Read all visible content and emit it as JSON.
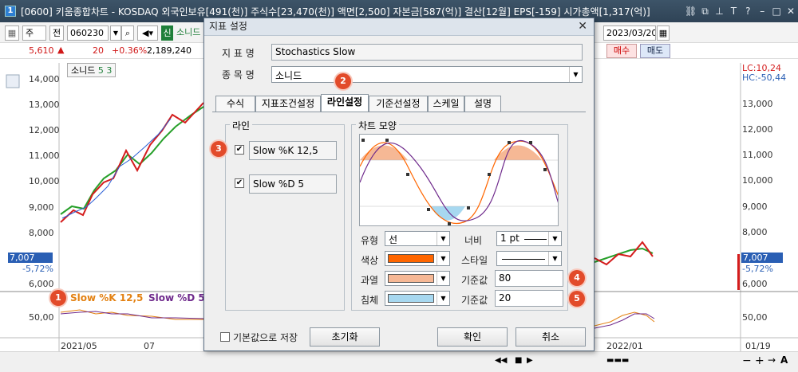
{
  "window": {
    "title": "[0600] 키움종합차트 - KOSDAQ 외국인보유[491(천)] 주식수[23,470(천)] 액면[2,500] 자본금[587(억)] 결산[12월] EPS[-159] 시가총액[1,317(억)]",
    "app_number": "1"
  },
  "toolbar": {
    "market": "주",
    "period": "전",
    "code": "060230",
    "new_badge": "신",
    "stock_name": "소니드",
    "date": "2023/03/20"
  },
  "quote": {
    "price": "5,610",
    "change": "20",
    "change_pct": "+0.36%",
    "volume": "2,189,240",
    "buy_label": "매수",
    "sell_label": "매도"
  },
  "chart": {
    "legend_name": "소니드",
    "legend_values": "5  3",
    "y_labels": [
      "14,000",
      "13,000",
      "12,000",
      "11,000",
      "10,000",
      "9,000",
      "8,000",
      "7,000",
      "6,000"
    ],
    "right_y_labels": [
      "14,000",
      "13,000",
      "12,000",
      "11,000",
      "10,000",
      "9,000",
      "8,000",
      "7,000",
      "6,000"
    ],
    "lc_label": "LC:10,24",
    "hc_label": "HC:-50,44",
    "price_tag": "7,007",
    "price_change_tag": "-5,72%",
    "stoch_legend_k": "Slow %K 12,5",
    "stoch_legend_d": "Slow %D 5",
    "stoch_y": "50,00",
    "x_labels": [
      "2021/05",
      "07",
      "2022/01",
      "01/19"
    ]
  },
  "dialog": {
    "title": "지표 설정",
    "indicator_label": "지 표 명",
    "indicator_value": "Stochastics Slow",
    "stock_label": "종 목 명",
    "stock_value": "소니드",
    "tabs": [
      "수식",
      "지표조건설정",
      "라인설정",
      "기준선설정",
      "스케일",
      "설명"
    ],
    "active_tab": "라인설정",
    "line_group": "라인",
    "line1": "Slow %K 12,5",
    "line2": "Slow %D 5",
    "shape_group": "차트 모양",
    "type_label": "유형",
    "type_value": "선",
    "width_label": "너비",
    "width_value": "1 pt",
    "color_label": "색상",
    "style_label": "스타일",
    "overbought_label": "과열",
    "oversold_label": "침체",
    "base1_label": "기준값",
    "base1_value": "80",
    "base2_label": "기준값",
    "base2_value": "20",
    "save_default": "기본값으로 저장",
    "reset": "초기화",
    "ok": "확인",
    "cancel": "취소",
    "colors": {
      "line": "#ff6600",
      "overbought": "#f6b895",
      "oversold": "#a7d8f0"
    }
  },
  "badges": [
    "1",
    "2",
    "3",
    "4",
    "5"
  ]
}
